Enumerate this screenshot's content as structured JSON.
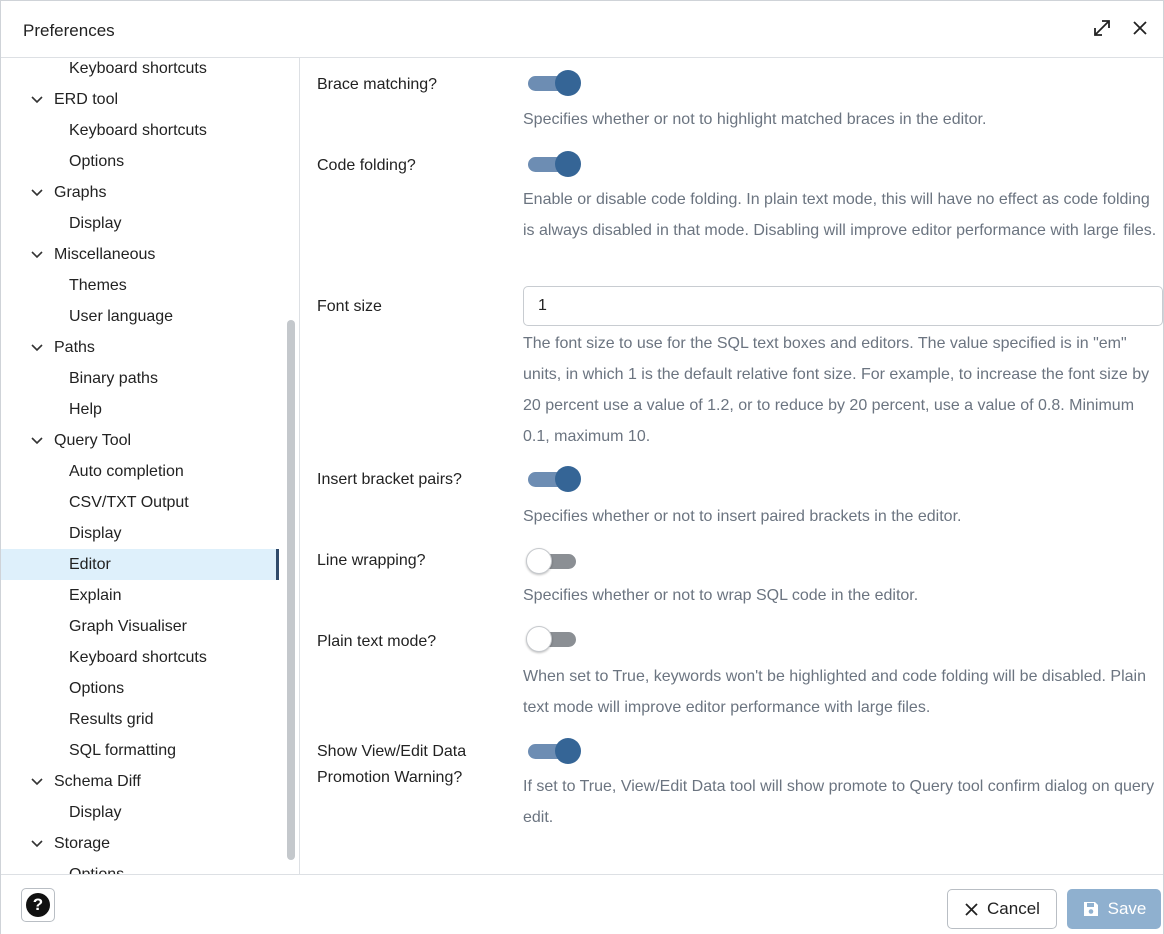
{
  "dialog": {
    "title": "Preferences"
  },
  "sidebar": {
    "items": [
      {
        "label": "Keyboard shortcuts",
        "level": 2
      },
      {
        "label": "ERD tool",
        "level": 1
      },
      {
        "label": "Keyboard shortcuts",
        "level": 2
      },
      {
        "label": "Options",
        "level": 2
      },
      {
        "label": "Graphs",
        "level": 1
      },
      {
        "label": "Display",
        "level": 2
      },
      {
        "label": "Miscellaneous",
        "level": 1
      },
      {
        "label": "Themes",
        "level": 2
      },
      {
        "label": "User language",
        "level": 2
      },
      {
        "label": "Paths",
        "level": 1
      },
      {
        "label": "Binary paths",
        "level": 2
      },
      {
        "label": "Help",
        "level": 2
      },
      {
        "label": "Query Tool",
        "level": 1
      },
      {
        "label": "Auto completion",
        "level": 2
      },
      {
        "label": "CSV/TXT Output",
        "level": 2
      },
      {
        "label": "Display",
        "level": 2
      },
      {
        "label": "Editor",
        "level": 2,
        "selected": true
      },
      {
        "label": "Explain",
        "level": 2
      },
      {
        "label": "Graph Visualiser",
        "level": 2
      },
      {
        "label": "Keyboard shortcuts",
        "level": 2
      },
      {
        "label": "Options",
        "level": 2
      },
      {
        "label": "Results grid",
        "level": 2
      },
      {
        "label": "SQL formatting",
        "level": 2
      },
      {
        "label": "Schema Diff",
        "level": 1
      },
      {
        "label": "Display",
        "level": 2
      },
      {
        "label": "Storage",
        "level": 1
      },
      {
        "label": "Options",
        "level": 2
      }
    ]
  },
  "settings": {
    "brace_matching": {
      "label": "Brace matching?",
      "enabled": true,
      "description": "Specifies whether or not to highlight matched braces in the editor."
    },
    "code_folding": {
      "label": "Code folding?",
      "enabled": true,
      "description": "Enable or disable code folding. In plain text mode, this will have no effect as code folding is always disabled in that mode. Disabling will improve editor performance with large files."
    },
    "font_size": {
      "label": "Font size",
      "value": "1",
      "description": "The font size to use for the SQL text boxes and editors. The value specified is in \"em\" units, in which 1 is the default relative font size. For example, to increase the font size by 20 percent use a value of 1.2, or to reduce by 20 percent, use a value of 0.8. Minimum 0.1, maximum 10."
    },
    "insert_bracket_pairs": {
      "label": "Insert bracket pairs?",
      "enabled": true,
      "description": "Specifies whether or not to insert paired brackets in the editor."
    },
    "line_wrapping": {
      "label": "Line wrapping?",
      "enabled": false,
      "description": "Specifies whether or not to wrap SQL code in the editor."
    },
    "plain_text_mode": {
      "label": "Plain text mode?",
      "enabled": false,
      "description": "When set to True, keywords won't be highlighted and code folding will be disabled. Plain text mode will improve editor performance with large files."
    },
    "promotion_warning": {
      "label_line1": "Show View/Edit Data",
      "label_line2": "Promotion Warning?",
      "enabled": true,
      "description": "If set to True, View/Edit Data tool will show promote to Query tool confirm dialog on query edit."
    }
  },
  "footer": {
    "help_label": "?",
    "cancel_label": "Cancel",
    "save_label": "Save"
  },
  "icons": {
    "expand": "expand-icon",
    "close": "close-icon",
    "chevron": "chevron-down-icon",
    "cancel": "close-icon",
    "save": "floppy-disk-icon",
    "help": "question-circle-icon"
  },
  "colors": {
    "toggle_on_knob": "#356596",
    "toggle_on_track": "#6d8db3",
    "selected_bg": "#def0fb",
    "save_button": "#8fb0cf"
  }
}
